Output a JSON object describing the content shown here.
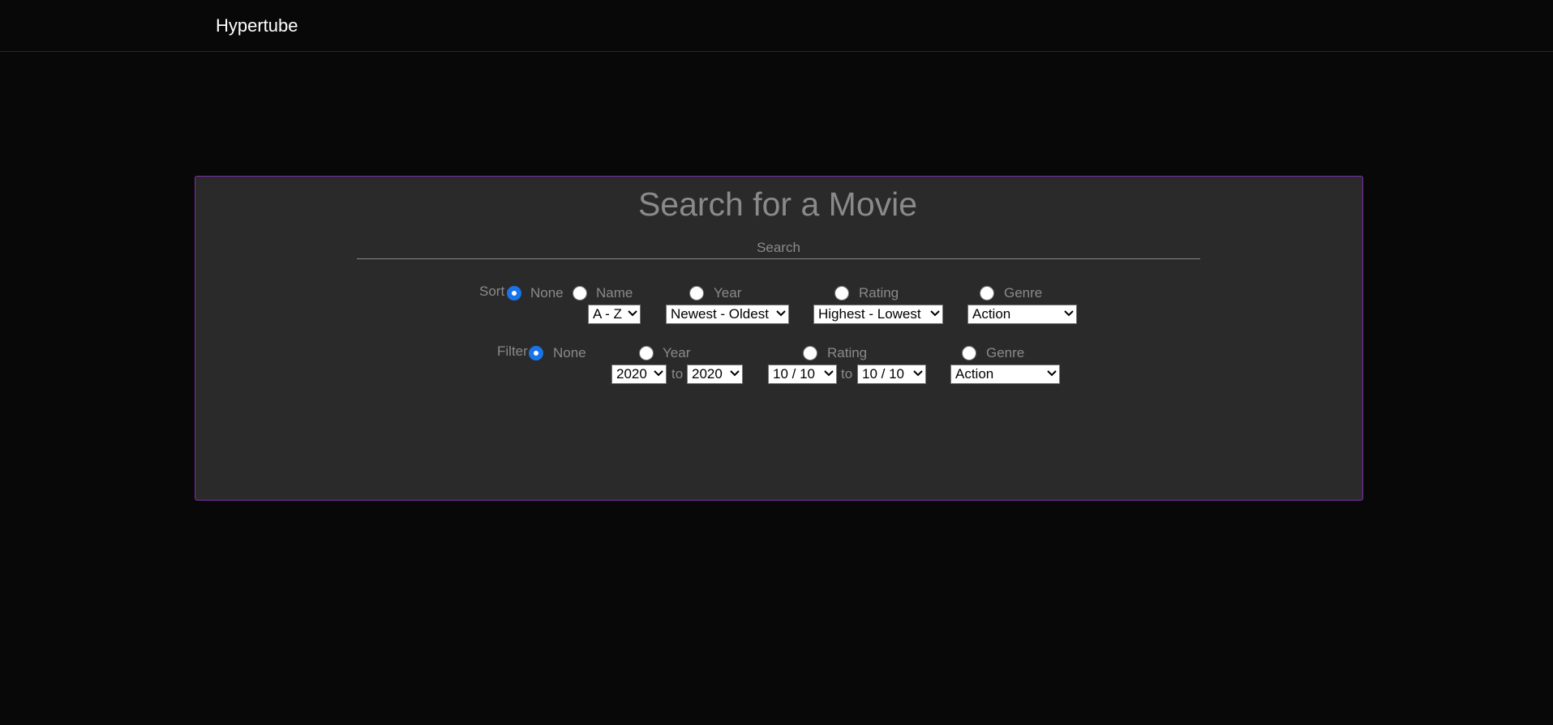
{
  "header": {
    "brand": "Hypertube"
  },
  "search": {
    "title": "Search for a Movie",
    "placeholder": "Search"
  },
  "sort": {
    "label": "Sort",
    "options": {
      "none": "None",
      "name": "Name",
      "year": "Year",
      "rating": "Rating",
      "genre": "Genre"
    },
    "selected": "None",
    "selects": {
      "name": "A - Z",
      "year": "Newest - Oldest",
      "rating": "Highest - Lowest",
      "genre": "Action"
    }
  },
  "filter": {
    "label": "Filter",
    "options": {
      "none": "None",
      "year": "Year",
      "rating": "Rating",
      "genre": "Genre"
    },
    "selected": "None",
    "selects": {
      "year_from": "2020",
      "year_to": "2020",
      "rating_from": "10 / 10",
      "rating_to": "10 / 10",
      "genre": "Action"
    },
    "range_word": "to"
  },
  "colors": {
    "background": "#080808",
    "panel": "#2a2a2a",
    "panel_border": "#7b2fa8",
    "text_muted": "#8a8a8a",
    "radio_checked": "#1a73e8"
  }
}
